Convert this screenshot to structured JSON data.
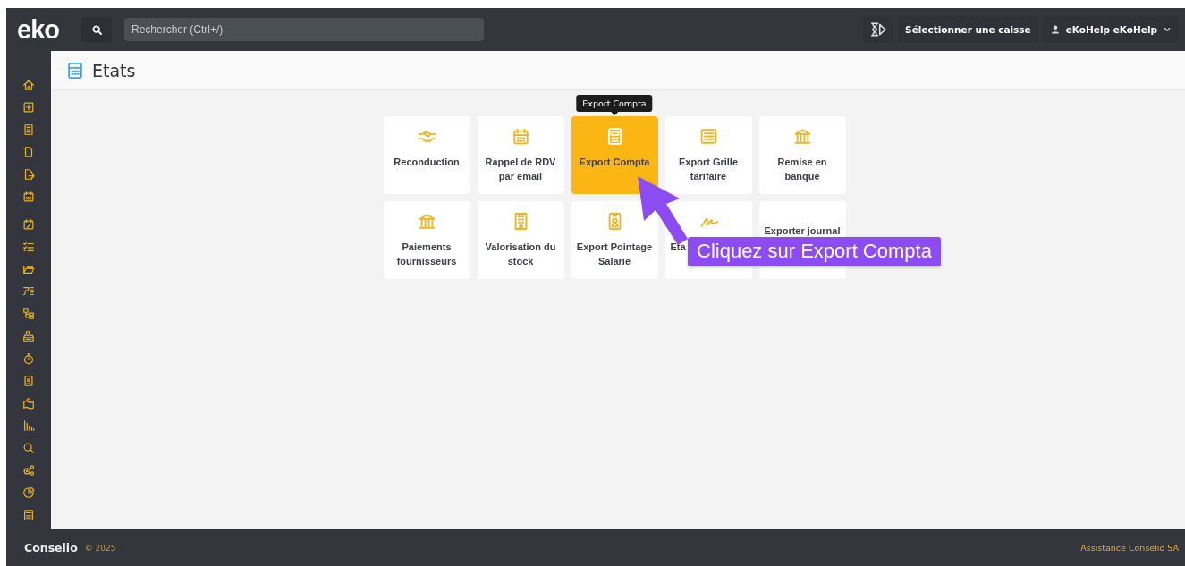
{
  "header": {
    "logo": "eko",
    "search": {
      "placeholder": "Rechercher (Ctrl+/)"
    },
    "cash_register_button": "Sélectionner une caisse",
    "user_menu": "eKoHelp eKoHelp"
  },
  "page_title": "Etats",
  "tiles": [
    {
      "label": "Reconduction",
      "selected": false
    },
    {
      "label": "Rappel de RDV par email",
      "selected": false
    },
    {
      "label": "Export Compta",
      "selected": true,
      "tooltip": "Export Compta"
    },
    {
      "label": "Export Grille tarifaire",
      "selected": false
    },
    {
      "label": "Remise en banque",
      "selected": false
    },
    {
      "label": "Paiements fournisseurs",
      "selected": false
    },
    {
      "label": "Valorisation du stock",
      "selected": false
    },
    {
      "label": "Export Pointage Salarie",
      "selected": false
    },
    {
      "label": "Eta",
      "selected": false
    },
    {
      "label": "Exporter journal",
      "selected": false
    }
  ],
  "callout": {
    "text": "Cliquez sur Export Compta"
  },
  "footer": {
    "brand": "Conselio",
    "copyright": "© 2025",
    "support_link": "Assistance Conselio SA"
  }
}
